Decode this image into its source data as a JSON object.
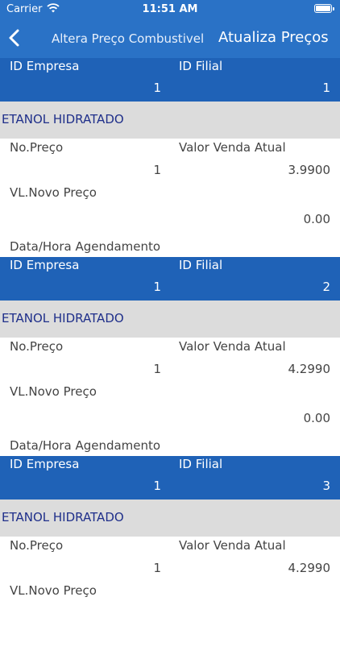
{
  "status_bar": {
    "carrier": "Carrier",
    "time": "11:51 AM"
  },
  "nav": {
    "back_label": "Altera Preço Combustivel",
    "title": "Atualiza Preços"
  },
  "colors": {
    "primary": "#2a72c6",
    "header_row": "#1f62b7",
    "section_bg": "#dcdcdc",
    "section_text": "#1f2f8a"
  },
  "labels": {
    "id_empresa": "ID Empresa",
    "id_filial": "ID Filial",
    "no_preco": "No.Preço",
    "valor_venda_atual": "Valor Venda Atual",
    "vl_novo_preco": "VL.Novo Preço",
    "data_hora": "Data/Hora Agendamento"
  },
  "records": [
    {
      "id_empresa": "1",
      "id_filial": "1",
      "produto": "ETANOL HIDRATADO",
      "no_preco": "1",
      "valor_venda_atual": "3.9900",
      "vl_novo_preco": "0.00"
    },
    {
      "id_empresa": "1",
      "id_filial": "2",
      "produto": "ETANOL HIDRATADO",
      "no_preco": "1",
      "valor_venda_atual": "4.2990",
      "vl_novo_preco": "0.00"
    },
    {
      "id_empresa": "1",
      "id_filial": "3",
      "produto": "ETANOL HIDRATADO",
      "no_preco": "1",
      "valor_venda_atual": "4.2990",
      "vl_novo_preco": ""
    }
  ]
}
